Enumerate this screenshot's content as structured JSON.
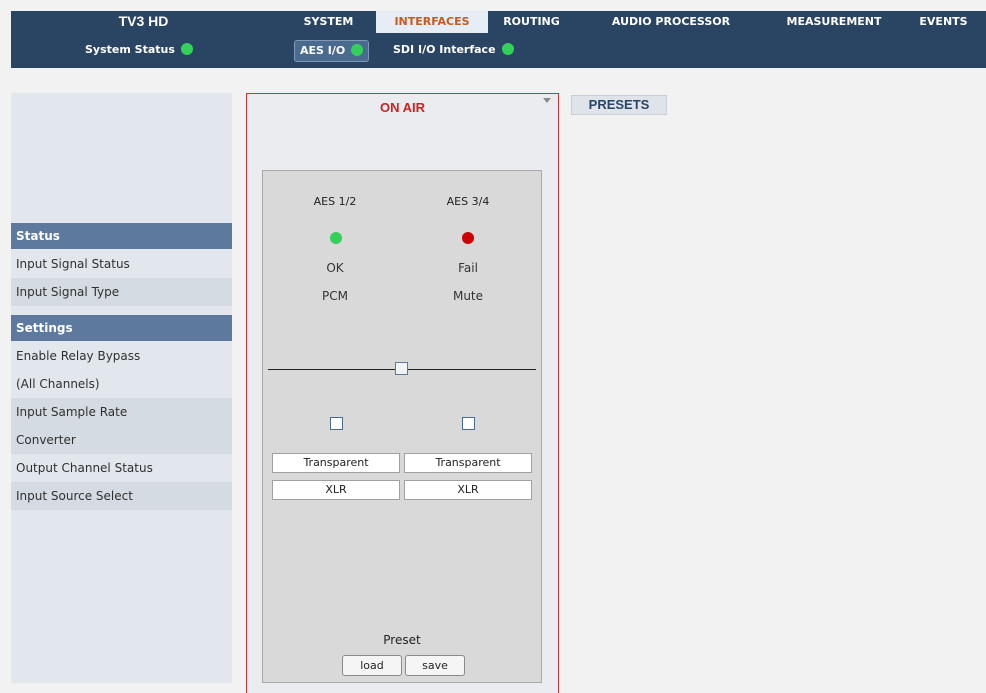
{
  "app": {
    "title": "TV3 HD"
  },
  "nav": {
    "tabs": [
      {
        "label": "SYSTEM"
      },
      {
        "label": "INTERFACES"
      },
      {
        "label": "ROUTING"
      },
      {
        "label": "AUDIO PROCESSOR"
      },
      {
        "label": "MEASUREMENT"
      },
      {
        "label": "EVENTS"
      }
    ],
    "active": "INTERFACES"
  },
  "subnav": {
    "system_status": "System Status",
    "aes_io": "AES I/O",
    "sdi_io": "SDI I/O Interface"
  },
  "sidebar": {
    "status_header": "Status",
    "status_rows": [
      "Input Signal Status",
      "Input Signal Type"
    ],
    "settings_header": "Settings",
    "settings_rows": [
      "Enable Relay Bypass",
      "(All Channels)",
      "Input Sample Rate",
      "Converter",
      "Output Channel Status",
      "Input Source Select"
    ]
  },
  "onair": {
    "title": "ON AIR",
    "channels": [
      {
        "label": "AES 1/2",
        "led_color": "#33d05a",
        "status": "OK",
        "type": "PCM",
        "channel_status": "Transparent",
        "source": "XLR"
      },
      {
        "label": "AES 3/4",
        "led_color": "#cc0000",
        "status": "Fail",
        "type": "Mute",
        "channel_status": "Transparent",
        "source": "XLR"
      }
    ],
    "preset_label": "Preset",
    "load_label": "load",
    "save_label": "save"
  },
  "presets": {
    "label": "PRESETS"
  },
  "colors": {
    "nav_bg": "#2a4564",
    "accent": "#c65a1f",
    "ok": "#33d05a",
    "fail": "#cc0000",
    "onair_border": "#cc3333"
  }
}
